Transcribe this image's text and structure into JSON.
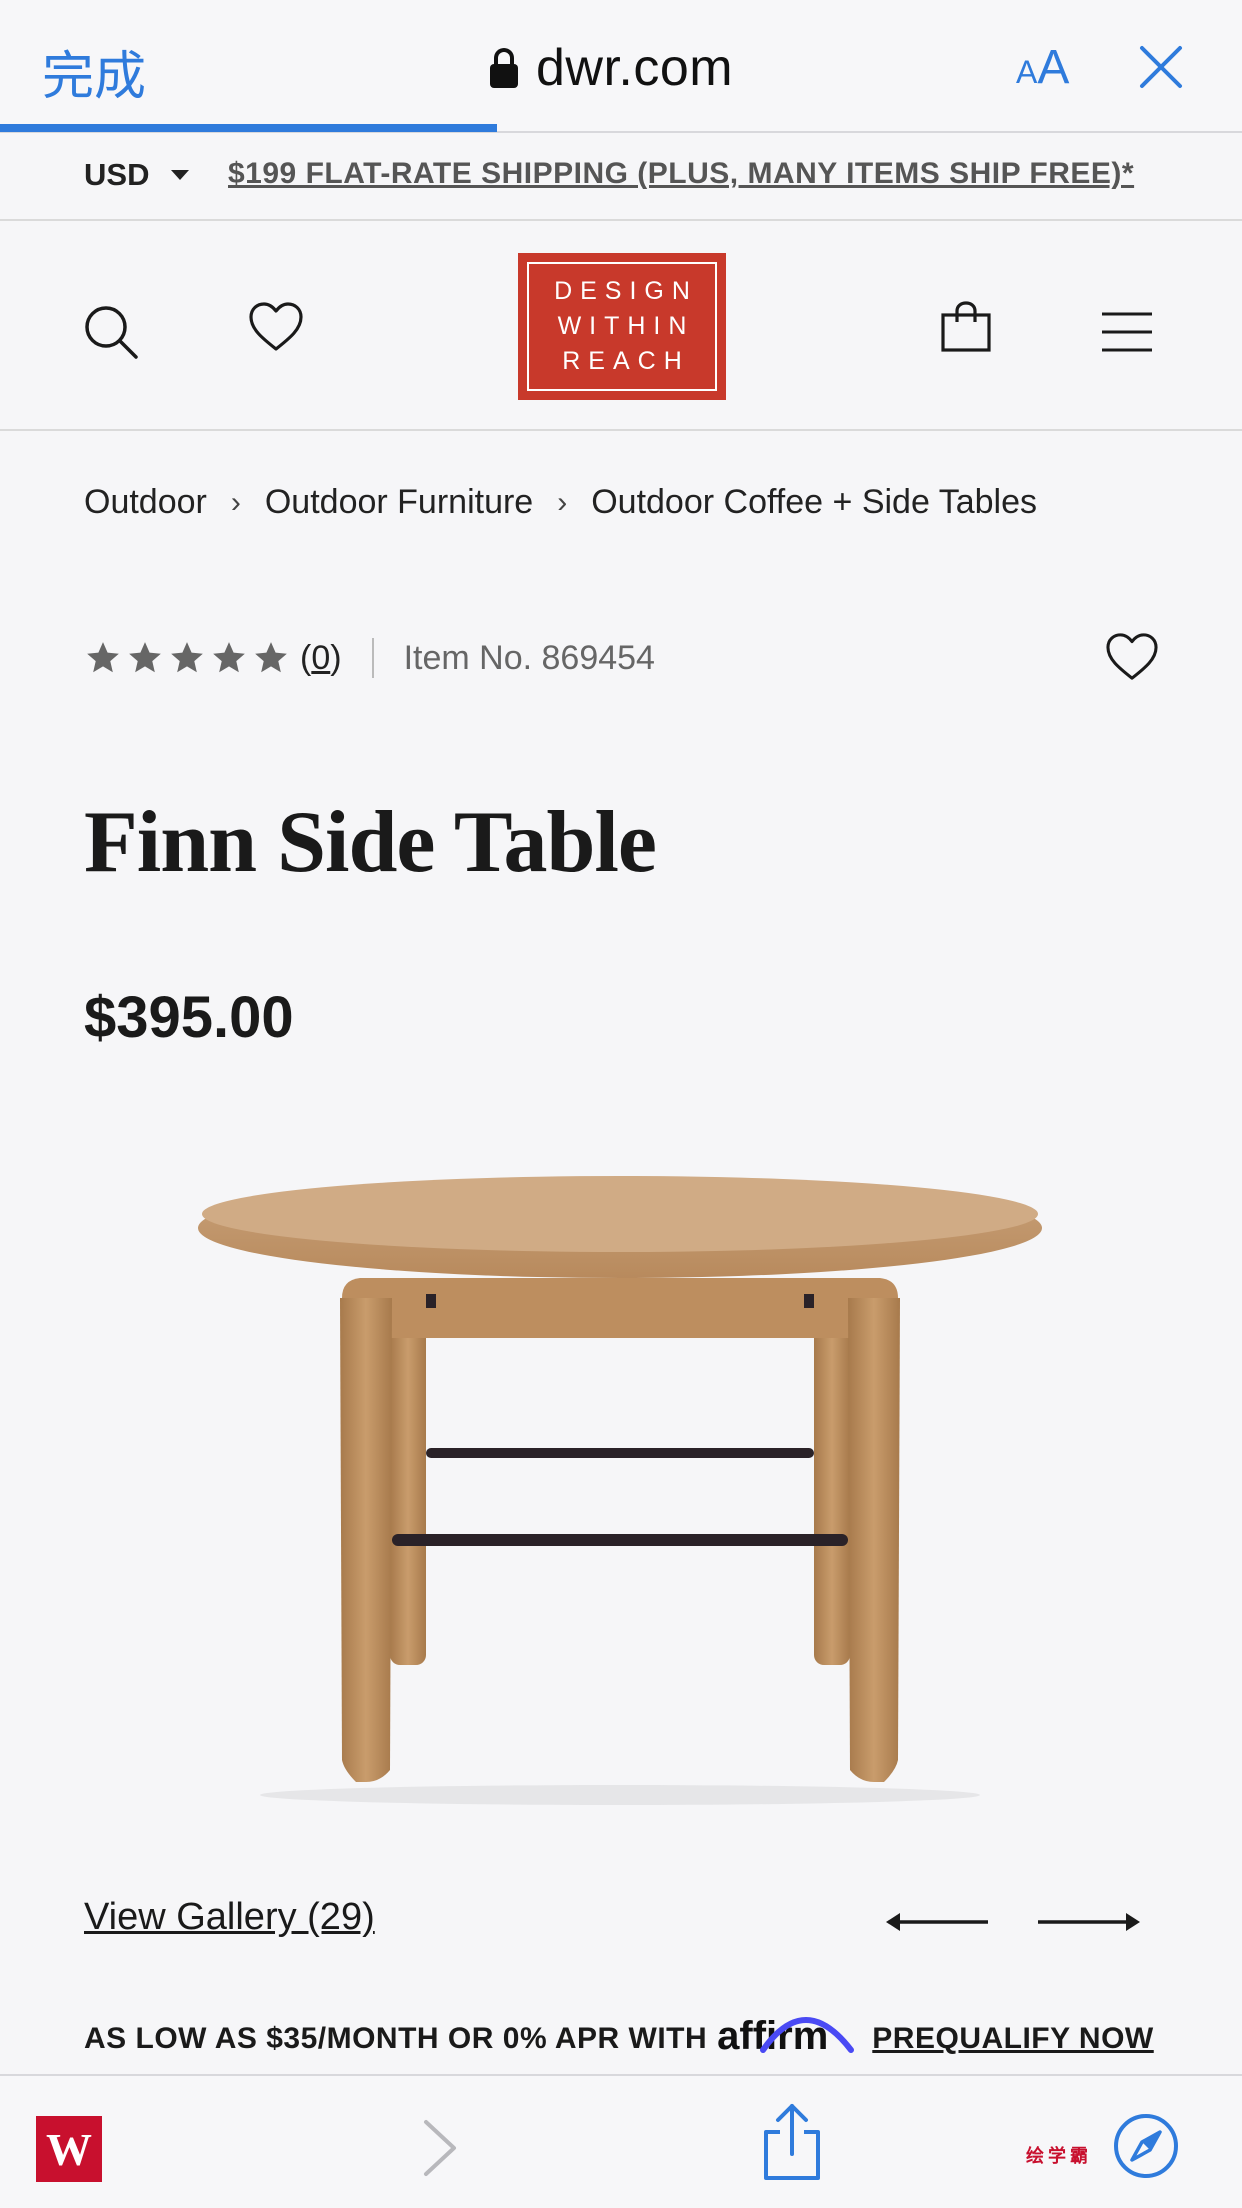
{
  "safari": {
    "done_label": "完成",
    "url": "dwr.com",
    "text_size_small": "A",
    "text_size_big": "A",
    "load_progress": 0.4
  },
  "promo": {
    "currency": "USD",
    "shipping_text": "$199 FLAT-RATE SHIPPING (PLUS, MANY ITEMS SHIP FREE)*"
  },
  "header": {
    "logo_lines": [
      "DESIGN",
      "WITHIN",
      "REACH"
    ],
    "brand_color": "#c8392b"
  },
  "breadcrumb": [
    "Outdoor",
    "Outdoor Furniture",
    "Outdoor Coffee + Side Tables"
  ],
  "product": {
    "rating_stars": 5,
    "rating_value": 0,
    "review_count_open": "(",
    "review_count": "0",
    "review_count_close": ")",
    "item_number": "Item No. 869454",
    "title": "Finn Side Table",
    "price": "$395.00",
    "image_alt": "Finn Side Table product photo"
  },
  "gallery": {
    "link_label": "View Gallery (29)"
  },
  "financing": {
    "text": "AS LOW AS $35/MONTH OR 0% APR WITH",
    "provider": "affirm",
    "cta": "PREQUALIFY NOW"
  },
  "toolbar": {
    "logo_letter": "W",
    "red_text": "绘学霸"
  },
  "colors": {
    "accent_blue": "#2f7bdc",
    "brand_red": "#c8392b",
    "affirm_blue": "#4a4af4"
  }
}
